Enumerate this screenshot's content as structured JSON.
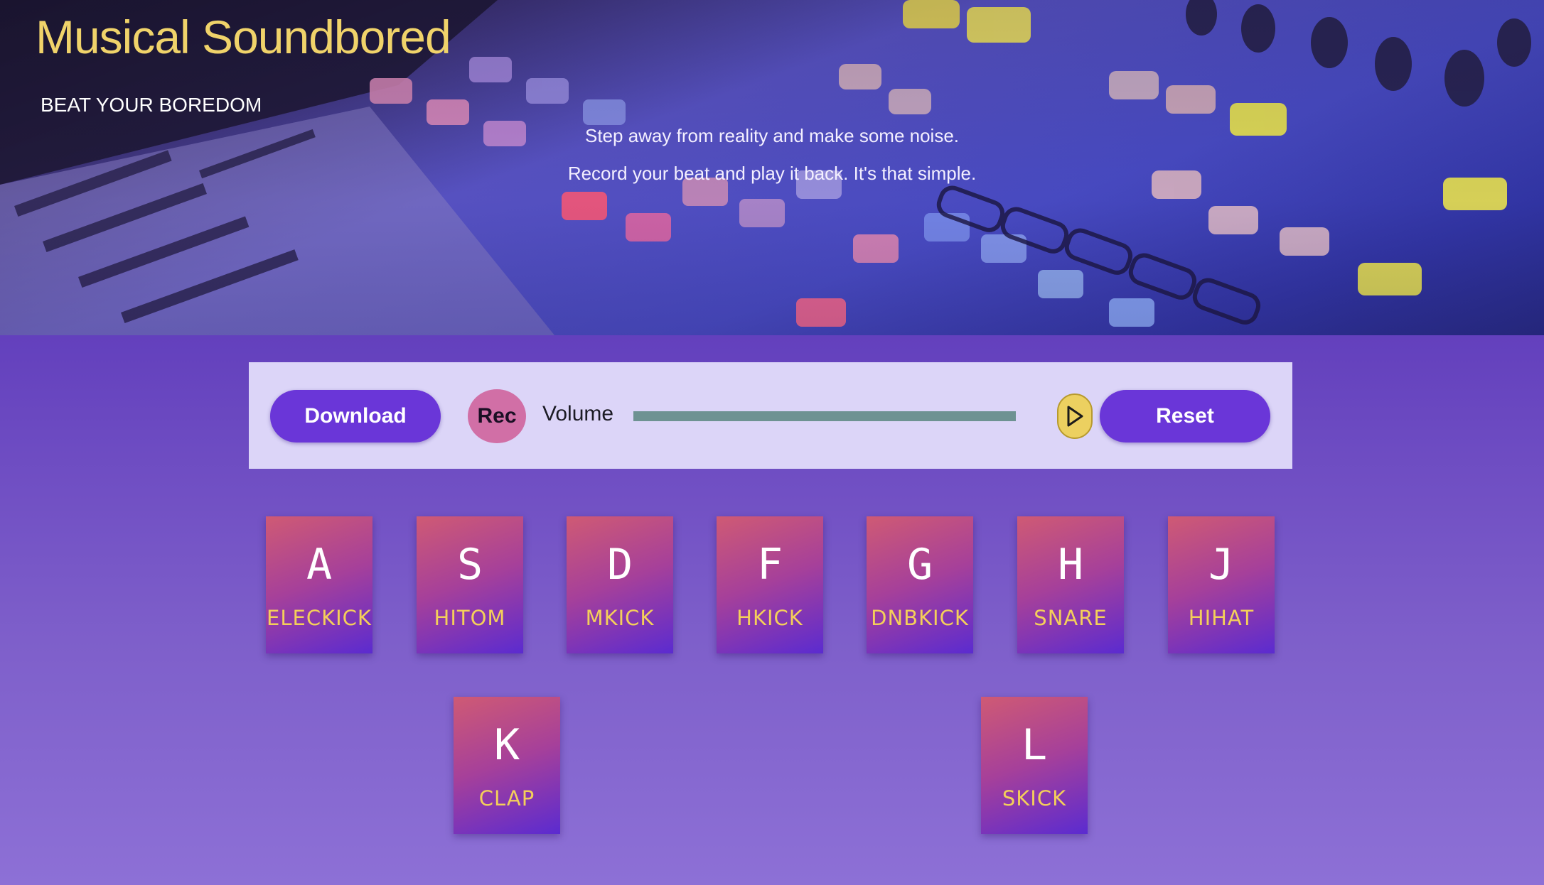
{
  "header": {
    "title": "Musical Soundbored",
    "tagline": "BEAT YOUR BOREDOM",
    "blurb_line1": "Step away from reality and make some noise.",
    "blurb_line2": "Record your beat and play it back. It's that simple."
  },
  "controls": {
    "download_label": "Download",
    "rec_label": "Rec",
    "volume_label": "Volume",
    "play_icon": "play-triangle-icon",
    "reset_label": "Reset"
  },
  "pads": [
    {
      "key": "A",
      "sound": "ELECKICK"
    },
    {
      "key": "S",
      "sound": "HITOM"
    },
    {
      "key": "D",
      "sound": "MKICK"
    },
    {
      "key": "F",
      "sound": "HKICK"
    },
    {
      "key": "G",
      "sound": "DNBKICK"
    },
    {
      "key": "H",
      "sound": "SNARE"
    },
    {
      "key": "J",
      "sound": "HIHAT"
    },
    {
      "key": "K",
      "sound": "CLAP"
    },
    {
      "key": "L",
      "sound": "SKICK"
    }
  ],
  "colors": {
    "title": "#f0d36a",
    "pad_label": "#f4cf5a",
    "button": "#6a36d8",
    "rec": "#d16fa6",
    "play": "#ecd060",
    "volume_track": "#6e9292",
    "control_bar_bg": "#dcd5f8"
  }
}
